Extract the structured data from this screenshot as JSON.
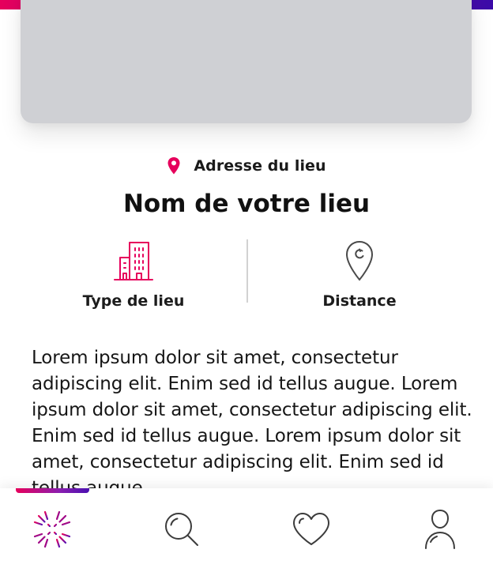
{
  "venue": {
    "address": "Adresse du lieu",
    "name": "Nom de votre lieu"
  },
  "info": {
    "type_label": "Type de lieu",
    "distance_label": "Distance"
  },
  "description": "Lorem ipsum dolor sit amet, consectetur adipiscing elit. Enim sed id tellus augue. Lorem ipsum dolor sit amet, consectetur adipiscing elit. Enim sed id tellus augue. Lorem ipsum dolor sit amet, consectetur adipiscing elit. Enim sed id tellus augue.",
  "icons": {
    "address": "map-pin-icon",
    "venue_type": "building-icon",
    "distance": "location-pin-icon"
  },
  "nav": {
    "items": [
      {
        "icon": "sparkle-home-icon",
        "active": true
      },
      {
        "icon": "search-icon",
        "active": false
      },
      {
        "icon": "heart-icon",
        "active": false
      },
      {
        "icon": "user-icon",
        "active": false
      }
    ]
  },
  "colors": {
    "accent_pink": "#e6005c",
    "accent_purple": "#3b0aa8",
    "image_placeholder": "#cfd0d4",
    "text": "#161616",
    "icon_gray": "#4a4a4a"
  }
}
